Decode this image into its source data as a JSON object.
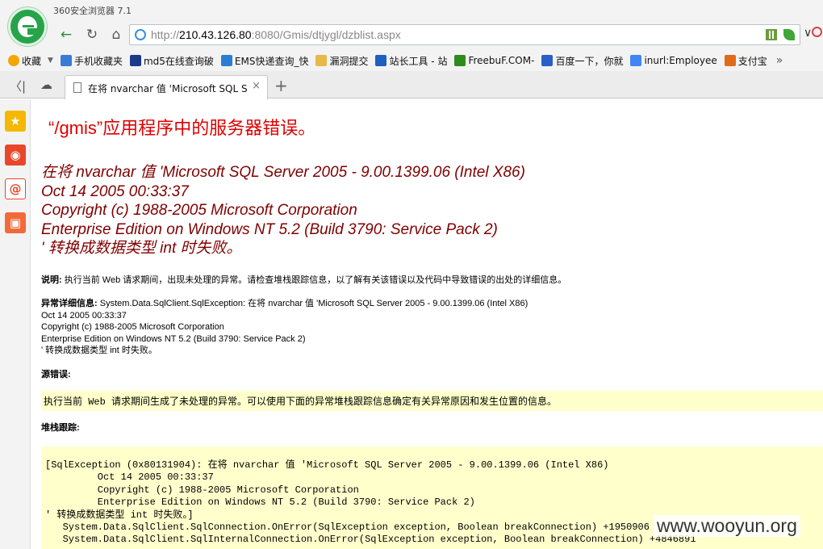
{
  "browser": {
    "app_title": "360安全浏览器 7.1",
    "url_prefix": "http://",
    "url_host": "210.43.126.80",
    "url_rest": ":8080/Gmis/dtjygl/dzblist.aspx"
  },
  "bookmarks": [
    {
      "label": "收藏",
      "color": "#f2a600"
    },
    {
      "label": "手机收藏夹",
      "color": "#3a7bd5"
    },
    {
      "label": "md5在线查询破",
      "color": "#1b3a8a"
    },
    {
      "label": "EMS快递查询_快",
      "color": "#2a7fd4"
    },
    {
      "label": "漏洞提交",
      "color": "#e8b84a"
    },
    {
      "label": "站长工具 - 站",
      "color": "#1f5fbf"
    },
    {
      "label": "FreebuF.COM-",
      "color": "#2e8b1e"
    },
    {
      "label": "百度一下，你就",
      "color": "#2a5ec9"
    },
    {
      "label": "inurl:Employee",
      "color": "#4285f4"
    },
    {
      "label": "支付宝",
      "color": "#e06b1b"
    }
  ],
  "tab": {
    "label": "在将 nvarchar 值 'Microsoft SQL S"
  },
  "page": {
    "heading": "“/gmis”应用程序中的服务器错误。",
    "error_lines": "在将 nvarchar 值 'Microsoft SQL Server 2005 - 9.00.1399.06 (Intel X86)\nOct 14 2005 00:33:37\nCopyright (c) 1988-2005 Microsoft Corporation\nEnterprise Edition on Windows NT 5.2 (Build 3790: Service Pack 2)\n' 转换成数据类型 int 时失败。",
    "desc_label": "说明:",
    "desc_text": "执行当前 Web 请求期间，出现未处理的异常。请检查堆栈跟踪信息，以了解有关该错误以及代码中导致错误的出处的详细信息。",
    "exc_label": "异常详细信息:",
    "exc_first": "System.Data.SqlClient.SqlException: 在将 nvarchar 值 'Microsoft SQL Server 2005 - 9.00.1399.06 (Intel X86)",
    "exc_rest": "Oct 14 2005 00:33:37\nCopyright (c) 1988-2005 Microsoft Corporation\nEnterprise Edition on Windows NT 5.2 (Build 3790: Service Pack 2)\n' 转换成数据类型 int 时失败。",
    "source_label": "源错误:",
    "source_text": "执行当前 Web 请求期间生成了未处理的异常。可以使用下面的异常堆栈跟踪信息确定有关异常原因和发生位置的信息。",
    "stack_label": "堆栈跟踪:",
    "stack_text": "[SqlException (0x80131904): 在将 nvarchar 值 'Microsoft SQL Server 2005 - 9.00.1399.06 (Intel X86)\n         Oct 14 2005 00:33:37\n         Copyright (c) 1988-2005 Microsoft Corporation\n         Enterprise Edition on Windows NT 5.2 (Build 3790: Service Pack 2)\n' 转换成数据类型 int 时失败。]\n   System.Data.SqlClient.SqlConnection.OnError(SqlException exception, Boolean breakConnection) +1950906\n   System.Data.SqlClient.SqlInternalConnection.OnError(SqlException exception, Boolean breakConnection) +4846891"
  },
  "watermark": "www.wooyun.org"
}
